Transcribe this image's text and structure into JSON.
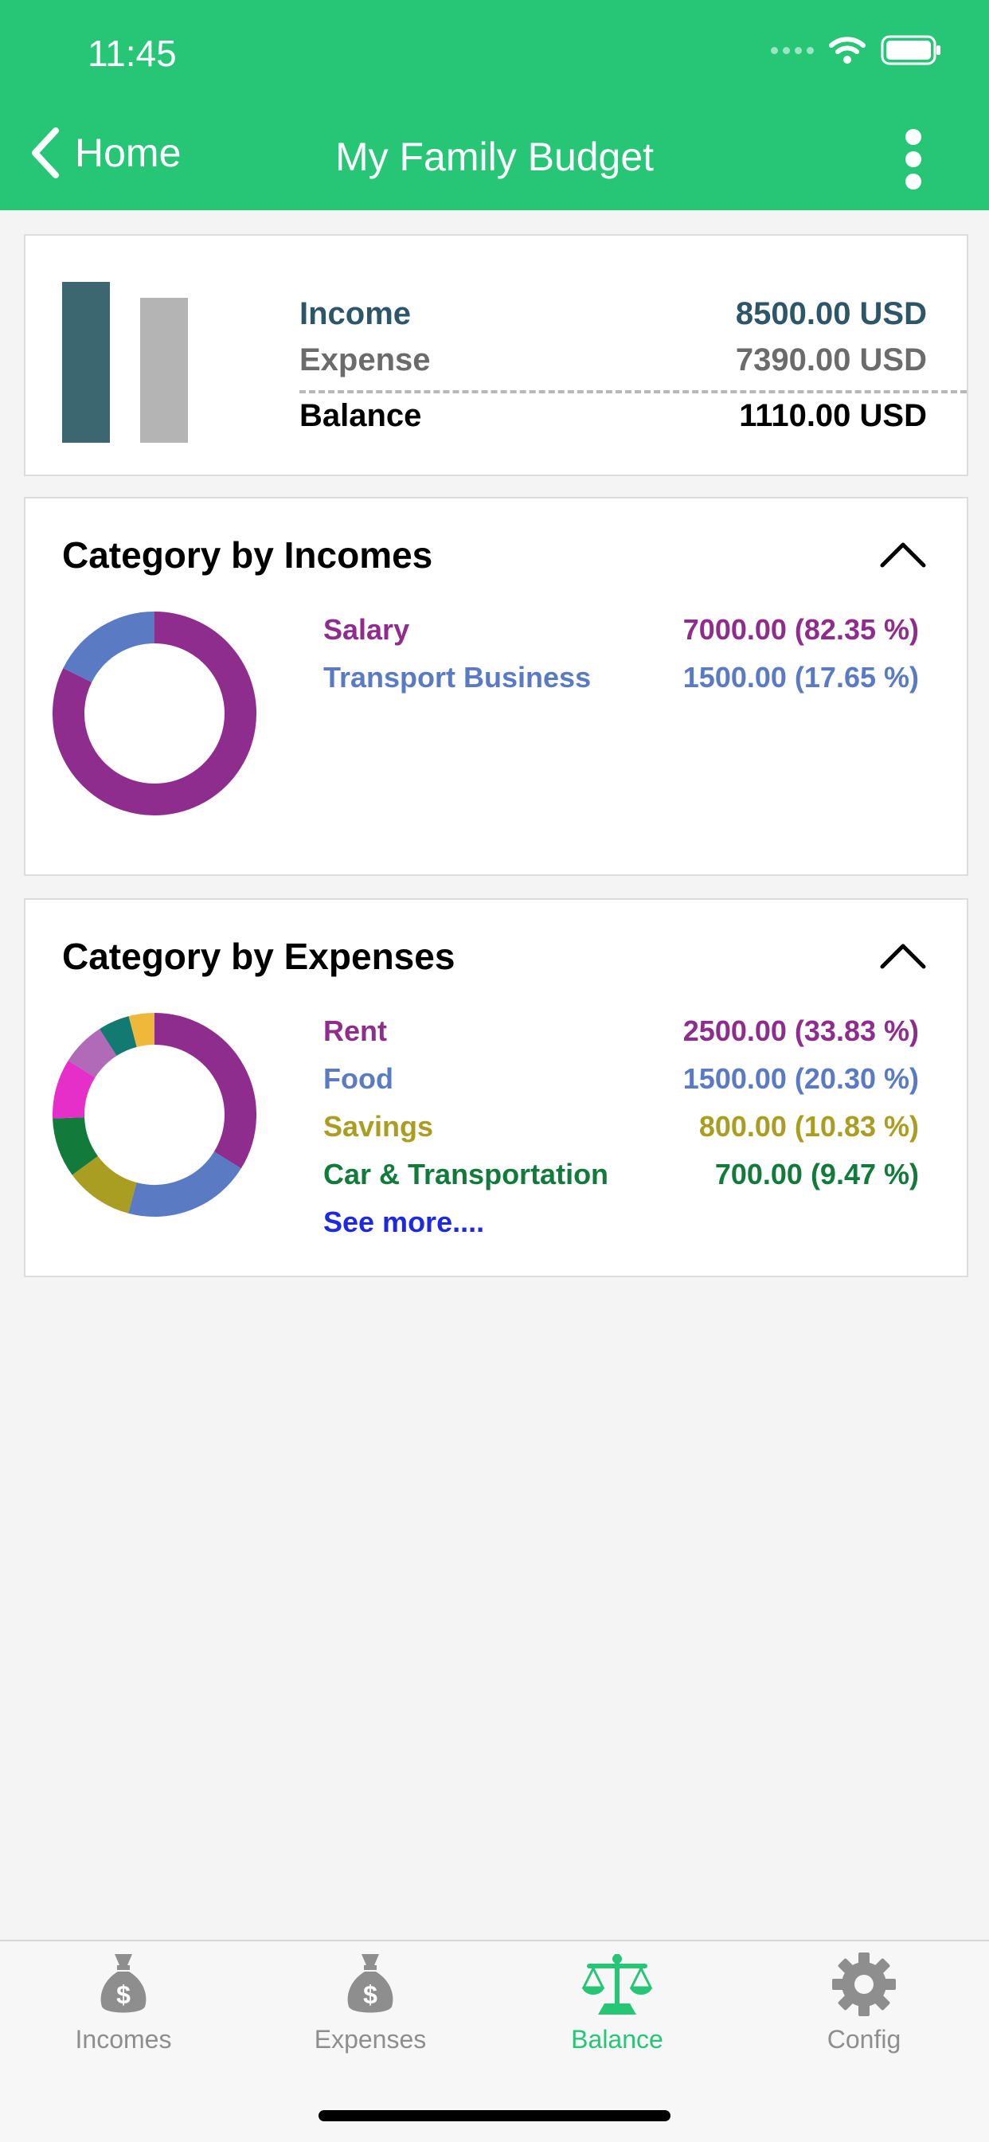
{
  "status_bar": {
    "time": "11:45"
  },
  "header": {
    "back_label": "Home",
    "title": "My Family Budget"
  },
  "summary": {
    "income_label": "Income",
    "income_value": "8500.00 USD",
    "expense_label": "Expense",
    "expense_value": "7390.00 USD",
    "balance_label": "Balance",
    "balance_value": "1110.00 USD"
  },
  "incomes": {
    "title": "Category by Incomes",
    "items": [
      {
        "label": "Salary",
        "value": "7000.00 (82.35 %)"
      },
      {
        "label": "Transport Business",
        "value": "1500.00 (17.65 %)"
      }
    ]
  },
  "expenses": {
    "title": "Category by Expenses",
    "items": [
      {
        "label": "Rent",
        "value": "2500.00 (33.83 %)"
      },
      {
        "label": "Food",
        "value": "1500.00 (20.30 %)"
      },
      {
        "label": "Savings",
        "value": "800.00 (10.83 %)"
      },
      {
        "label": "Car & Transportation",
        "value": "700.00 (9.47 %)"
      }
    ],
    "see_more": "See more...."
  },
  "chart_data": [
    {
      "type": "bar",
      "categories": [
        "Income",
        "Expense"
      ],
      "values": [
        8500,
        7390
      ],
      "ylim": [
        0,
        8500
      ],
      "colors": [
        "#3d6770",
        "#b4b4b4"
      ]
    },
    {
      "type": "pie",
      "categories": [
        "Salary",
        "Transport Business"
      ],
      "values": [
        82.35,
        17.65
      ],
      "colors": [
        "#8e2d8e",
        "#5a7bc4"
      ]
    },
    {
      "type": "pie",
      "values": [
        33.83,
        20.3,
        10.83,
        9.47,
        9.5,
        7.0,
        5.0,
        4.07
      ],
      "colors": [
        "#8e2d8e",
        "#5a7bc4",
        "#aa9e22",
        "#127a3a",
        "#e62ec8",
        "#b06ab8",
        "#137a72",
        "#efb83a"
      ]
    }
  ],
  "tabbar": {
    "tabs": [
      {
        "label": "Incomes"
      },
      {
        "label": "Expenses"
      },
      {
        "label": "Balance"
      },
      {
        "label": "Config"
      }
    ]
  },
  "colors": {
    "brand": "#27c677",
    "income": "#2d5668",
    "expense": "#6b6b6b",
    "link": "#1e28e0"
  }
}
